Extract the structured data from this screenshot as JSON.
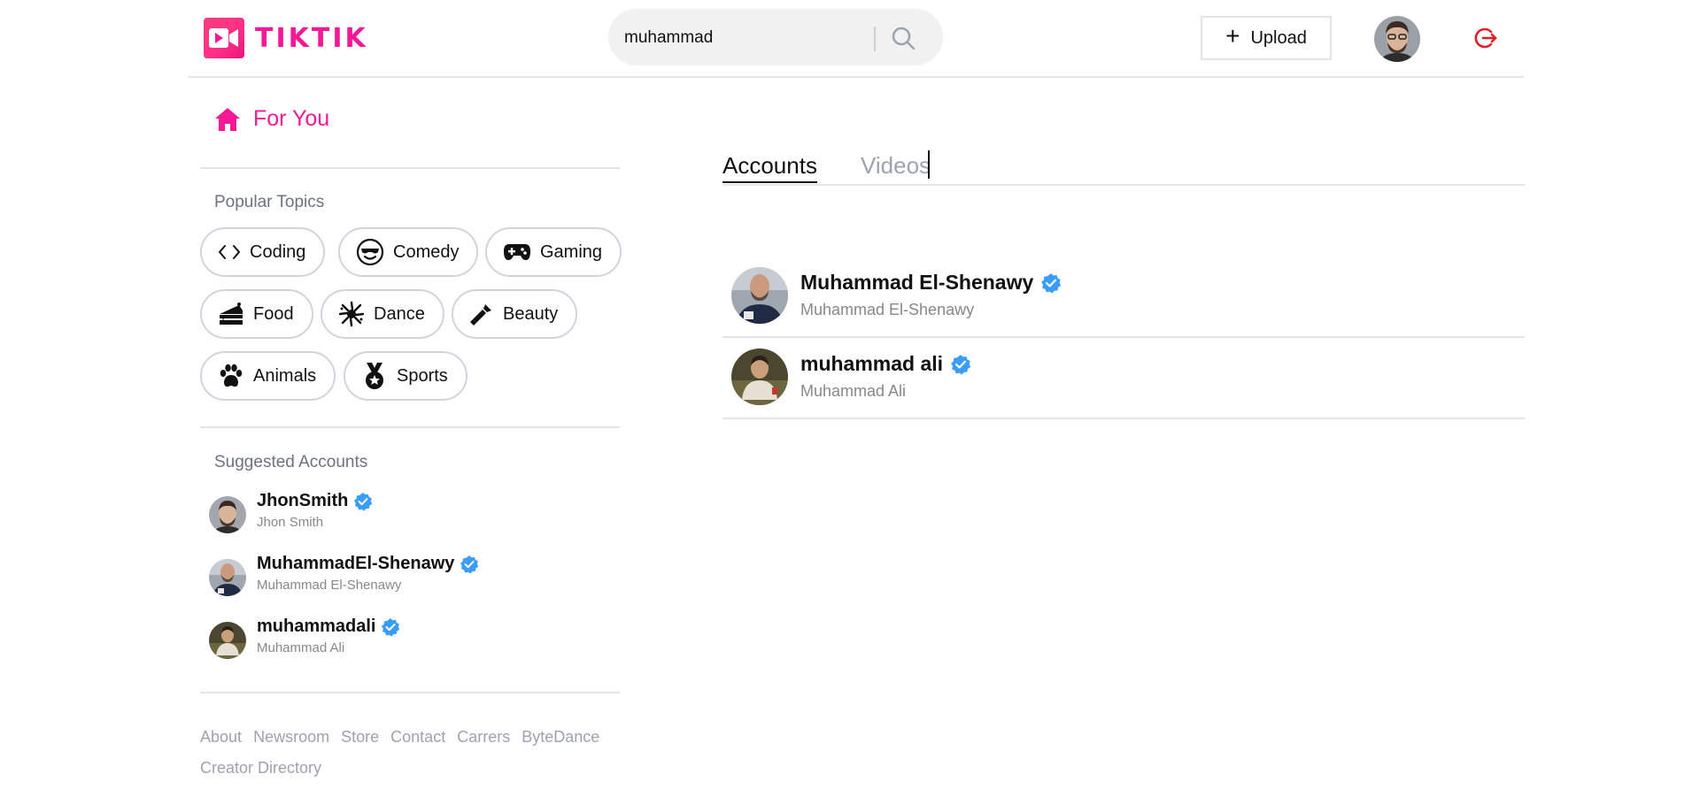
{
  "header": {
    "logo_text": "TIKTIK",
    "search": {
      "value": "muhammad"
    },
    "upload_label": "Upload"
  },
  "sidebar": {
    "for_you": "For You",
    "popular_topics_title": "Popular Topics",
    "topics": [
      {
        "label": "Coding",
        "icon": "code-icon"
      },
      {
        "label": "Comedy",
        "icon": "sunglasses-face-icon"
      },
      {
        "label": "Gaming",
        "icon": "gamepad-icon"
      },
      {
        "label": "Food",
        "icon": "cake-icon"
      },
      {
        "label": "Dance",
        "icon": "dance-icon"
      },
      {
        "label": "Beauty",
        "icon": "lipstick-icon"
      },
      {
        "label": "Animals",
        "icon": "paw-icon"
      },
      {
        "label": "Sports",
        "icon": "medal-icon"
      }
    ],
    "suggested_title": "Suggested Accounts",
    "suggested": [
      {
        "handle": "JhonSmith",
        "name": "Jhon Smith"
      },
      {
        "handle": "MuhammadEl-Shenawy",
        "name": "Muhammad El-Shenawy"
      },
      {
        "handle": "muhammadali",
        "name": "Muhammad Ali"
      }
    ],
    "footer_links": [
      "About",
      "Newsroom",
      "Store",
      "Contact",
      "Carrers",
      "ByteDance",
      "Creator Directory"
    ]
  },
  "main": {
    "tabs": [
      "Accounts",
      "Videos"
    ],
    "results": [
      {
        "handle": "Muhammad El-Shenawy",
        "name": "Muhammad El-Shenawy"
      },
      {
        "handle": "muhammad ali",
        "name": "Muhammad Ali"
      }
    ]
  },
  "colors": {
    "brand": "#f51997",
    "verified": "#3b9dfb",
    "logout": "#e11d2a"
  }
}
